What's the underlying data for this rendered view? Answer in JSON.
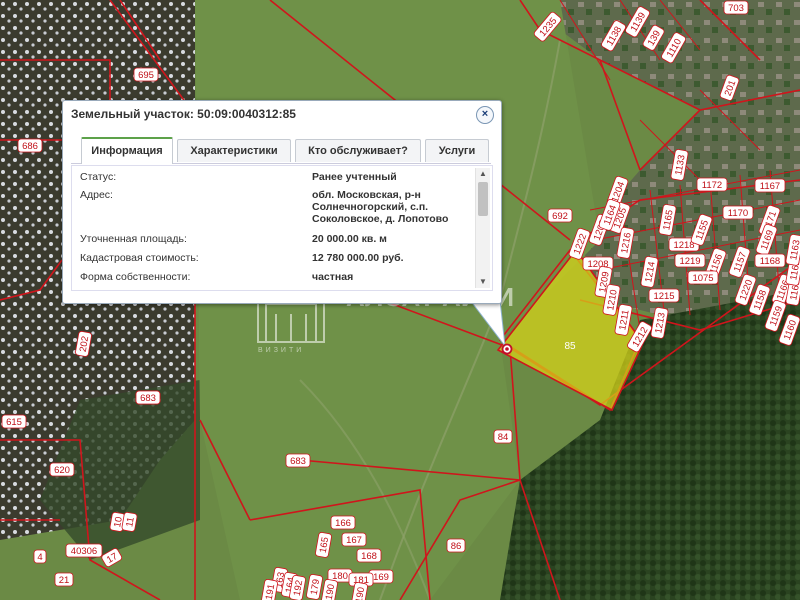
{
  "popup": {
    "title": "Земельный участок: 50:09:0040312:85",
    "close_glyph": "×",
    "tabs": [
      {
        "label": "Информация",
        "active": true
      },
      {
        "label": "Характеристики",
        "active": false
      },
      {
        "label": "Кто обслуживает?",
        "active": false
      },
      {
        "label": "Услуги",
        "active": false
      }
    ],
    "rows": [
      {
        "label": "Статус:",
        "value_lines": [
          "Ранее учтенный"
        ]
      },
      {
        "label": "Адрес:",
        "value_lines": [
          "обл. Московская, р-н",
          "Солнечногорский, с.п.",
          "Соколовское, д. Лопотово"
        ]
      },
      {
        "label": "Уточненная площадь:",
        "value_lines": [
          "20 000.00 кв. м"
        ]
      },
      {
        "label": "Кадастровая стоимость:",
        "value_lines": [
          "12 780 000.00 руб."
        ]
      },
      {
        "label": "Форма собственности:",
        "value_lines": [
          "частная"
        ]
      }
    ],
    "scroll_up_glyph": "▲",
    "scroll_down_glyph": "▼"
  },
  "watermark": {
    "text": "АЛСАТ АЙТИ",
    "subtext": "ВИЗИТИ"
  },
  "selected_parcel": {
    "label": "85",
    "highlight_color": "#d8d618"
  },
  "parcel_labels": {
    "top_left": [
      "695",
      "686",
      "683"
    ],
    "left_lower": [
      "615",
      "620",
      "40306",
      "4",
      "21",
      "10",
      "11",
      "17",
      "202",
      "683"
    ],
    "center": [
      "692",
      "84",
      "683",
      "86"
    ],
    "top_right": [
      "1235",
      "1138",
      "1139",
      "139",
      "1110",
      "703",
      "201"
    ],
    "right_cluster": [
      "1133",
      "1204",
      "1172",
      "1205",
      "1170",
      "1171",
      "1209",
      "1216",
      "1218",
      "1155",
      "1222",
      "1208",
      "1209",
      "1210",
      "1211",
      "1212",
      "1213",
      "1214",
      "1215",
      "1219",
      "1156",
      "1157",
      "1169",
      "1168",
      "1167",
      "1166",
      "1075",
      "1220",
      "1158",
      "1159",
      "1160",
      "1161",
      "1162",
      "1163",
      "1164",
      "1165",
      "1206",
      "1217"
    ],
    "bottom_center": [
      "166",
      "167",
      "165",
      "168",
      "169",
      "179",
      "180",
      "181",
      "163",
      "164",
      "192",
      "191",
      "190",
      "190"
    ]
  },
  "colors": {
    "parcel_outline": "#d0151c",
    "label_bg": "#ffffff",
    "label_text": "#c01018",
    "field_green": "#6b8a45",
    "forest_dark": "#27401e"
  }
}
